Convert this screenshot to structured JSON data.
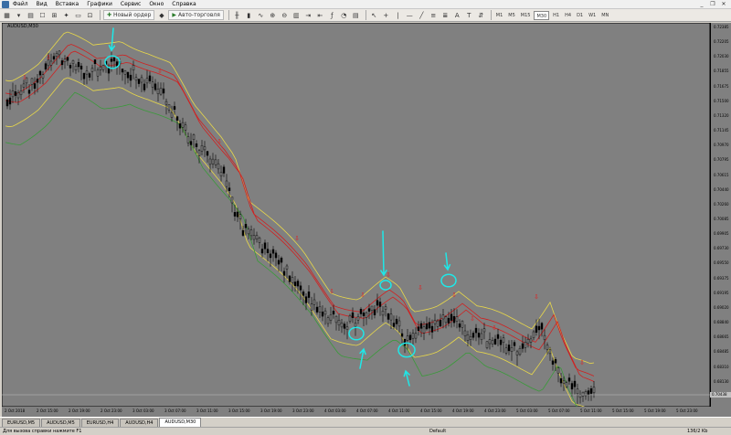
{
  "menu": {
    "items": [
      "Файл",
      "Вид",
      "Вставка",
      "Графики",
      "Сервис",
      "Окно",
      "Справка"
    ]
  },
  "toolbar": {
    "new_order_label": "Новый ордер",
    "autotrading_label": "Авто-торговля",
    "timeframes": [
      "M1",
      "M5",
      "M15",
      "M30",
      "H1",
      "H4",
      "D1",
      "W1",
      "MN"
    ],
    "active_timeframe": "M30"
  },
  "chart": {
    "title": "AUDUSD,M30",
    "current_price": "0.70438",
    "colors": {
      "background": "#808080",
      "candles": "#000000",
      "band_yellow": "#e8d84a",
      "band_red": "#d02020",
      "band_green": "#3a9a3a",
      "annotation": "#1ee8e8",
      "arrow_marker": "#e02020"
    }
  },
  "price_axis": {
    "labels": [
      "0.72385",
      "0.72205",
      "0.72030",
      "0.71855",
      "0.71675",
      "0.71500",
      "0.71320",
      "0.71145",
      "0.70970",
      "0.70795",
      "0.70615",
      "0.70440",
      "0.70260",
      "0.70085",
      "0.69905",
      "0.69730",
      "0.69550",
      "0.69375",
      "0.69195",
      "0.69020",
      "0.68840",
      "0.68665",
      "0.68485",
      "0.68310",
      "0.68130",
      "0.67955"
    ]
  },
  "time_axis": {
    "labels": [
      "2 Oct 2018",
      "2 Oct 15:00",
      "2 Oct 19:00",
      "2 Oct 23:00",
      "3 Oct 03:00",
      "3 Oct 07:00",
      "3 Oct 11:00",
      "3 Oct 15:00",
      "3 Oct 19:00",
      "3 Oct 23:00",
      "4 Oct 03:00",
      "4 Oct 07:00",
      "4 Oct 11:00",
      "4 Oct 15:00",
      "4 Oct 19:00",
      "4 Oct 23:00",
      "5 Oct 03:00",
      "5 Oct 07:00",
      "5 Oct 11:00",
      "5 Oct 15:00",
      "5 Oct 19:00",
      "5 Oct 23:00"
    ]
  },
  "tabs": {
    "items": [
      "EURUSD,M5",
      "AUDUSD,M5",
      "EURUSD,H4",
      "AUDUSD,H4",
      "AUDUSD,M30"
    ],
    "active": "AUDUSD,M30"
  },
  "status": {
    "help_text": "Для вызова справки нажмите F1",
    "profile": "Default",
    "traffic": "136/2 Kb"
  }
}
